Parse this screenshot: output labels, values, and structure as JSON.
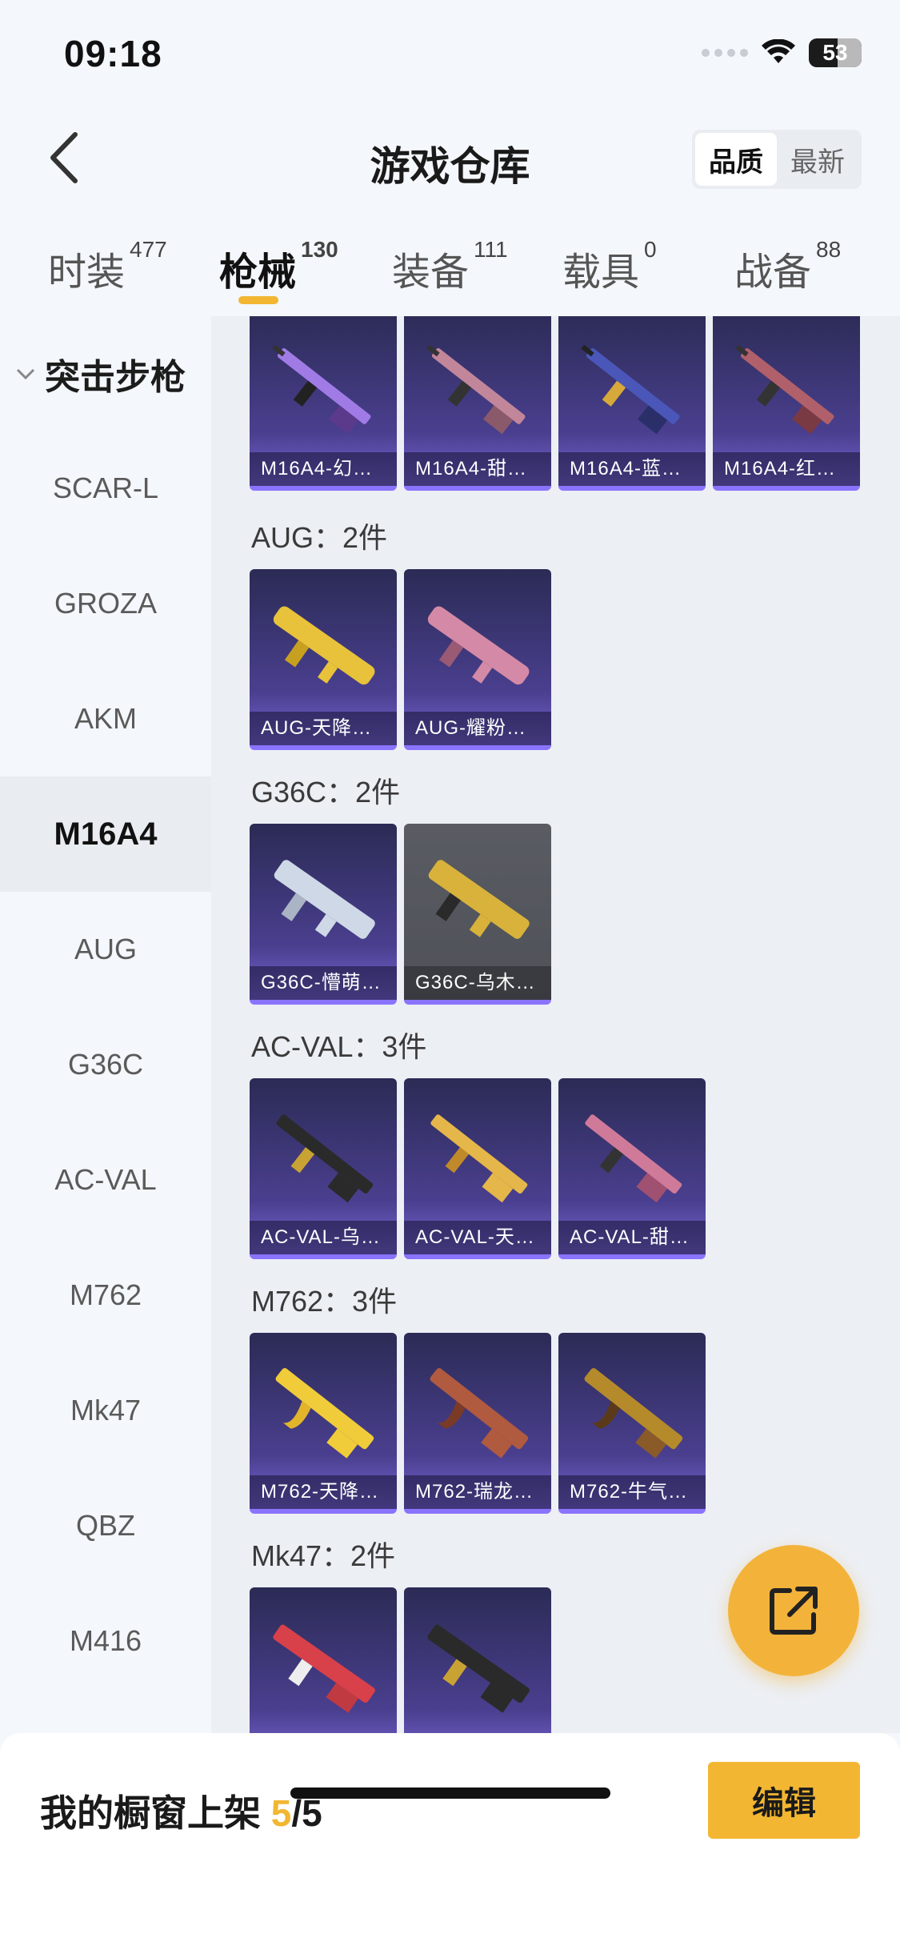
{
  "status_bar": {
    "time": "09:18",
    "battery": "53"
  },
  "header": {
    "title": "游戏仓库",
    "sort_options": [
      "品质",
      "最新"
    ],
    "sort_active": 0
  },
  "tabs": [
    {
      "label": "时装",
      "count": "477"
    },
    {
      "label": "枪械",
      "count": "130"
    },
    {
      "label": "装备",
      "count": "111"
    },
    {
      "label": "载具",
      "count": "0"
    },
    {
      "label": "战备",
      "count": "88"
    }
  ],
  "tab_active": 1,
  "sidebar": {
    "group_label": "突击步枪",
    "items": [
      "SCAR-L",
      "GROZA",
      "AKM",
      "M16A4",
      "AUG",
      "G36C",
      "AC-VAL",
      "M762",
      "Mk47",
      "QBZ",
      "M416"
    ],
    "active_index": 3
  },
  "content": {
    "groups": [
      {
        "label": "",
        "items": [
          "M16A4-幻…",
          "M16A4-甜…",
          "M16A4-蓝…",
          "M16A4-红…"
        ]
      },
      {
        "label": "AUG：2件",
        "items": [
          "AUG-天降…",
          "AUG-耀粉…"
        ]
      },
      {
        "label": "G36C：2件",
        "items": [
          "G36C-懵萌…",
          "G36C-乌木…"
        ]
      },
      {
        "label": "AC-VAL：3件",
        "items": [
          "AC-VAL-乌…",
          "AC-VAL-天…",
          "AC-VAL-甜…"
        ]
      },
      {
        "label": "M762：3件",
        "items": [
          "M762-天降…",
          "M762-瑞龙…",
          "M762-牛气…"
        ]
      },
      {
        "label": "Mk47：2件",
        "items": [
          "",
          ""
        ]
      }
    ]
  },
  "bottom_bar": {
    "showcase_label": "我的橱窗上架",
    "showcase_count": "5",
    "showcase_total": "/5",
    "edit_label": "编辑"
  },
  "colors": {
    "accent": "#f2b632",
    "card_purple": "#4a3f8f",
    "card_border": "#8a73ff"
  },
  "icons": {
    "back": "chevron-left-icon",
    "fab": "share-export-icon",
    "sidebar_group": "chevron-down-icon"
  }
}
